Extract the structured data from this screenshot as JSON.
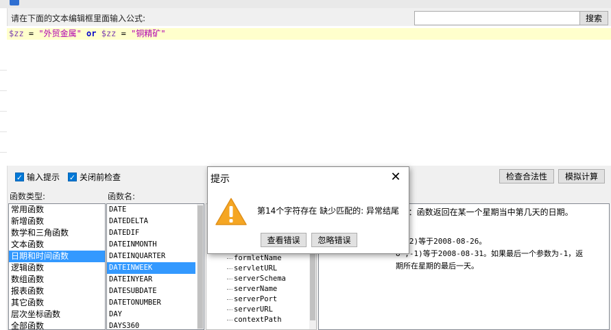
{
  "prompt_label": "请在下面的文本编辑框里面输入公式:",
  "search": {
    "value": "",
    "button_label": "搜索"
  },
  "editor": {
    "tokens": [
      "$zz",
      " = ",
      "\"外贸金属\"",
      " or ",
      "$zz",
      " = ",
      "\"铜精矿\""
    ]
  },
  "options": {
    "input_hint_label": "输入提示",
    "input_hint_checked": true,
    "check_on_close_label": "关闭前检查",
    "check_on_close_checked": true,
    "check_validity_label": "检查合法性",
    "simulate_label": "模拟计算"
  },
  "function_types": {
    "label": "函数类型:",
    "items": [
      "常用函数",
      "新增函数",
      "数学和三角函数",
      "文本函数",
      "日期和时间函数",
      "逻辑函数",
      "数组函数",
      "报表函数",
      "其它函数",
      "层次坐标函数",
      "全部函数"
    ],
    "selected_index": 4
  },
  "function_names": {
    "label": "函数名:",
    "items": [
      "DATE",
      "DATEDELTA",
      "DATEDIF",
      "DATEINMONTH",
      "DATEINQUARTER",
      "DATEINWEEK",
      "DATEINYEAR",
      "DATESUBDATE",
      "DATETONUMBER",
      "DAY",
      "DAYS360"
    ],
    "selected_index": 5
  },
  "params": {
    "items": [
      "formletName",
      "servletURL",
      "serverSchema",
      "serverName",
      "serverPort",
      "serverURL",
      "contextPath"
    ]
  },
  "description": {
    "lines": [
      ")：函数返回在某一个星期当中第几天的日期。",
      "",
      "8\",2)等于2008-08-26。",
      "8\",-1)等于2008-08-31。如果最后一个参数为-1，返",
      "期所在星期的最后一天。"
    ]
  },
  "dialog": {
    "title": "提示",
    "message": "第14个字符存在 缺少匹配的:  异常结尾",
    "view_error_label": "查看错误",
    "ignore_error_label": "忽略错误",
    "icon": "warning-icon",
    "close_icon": "close-icon"
  },
  "colors": {
    "selection": "#3399ff",
    "editor_highlight": "#ffffcc",
    "warning": "#f5a623",
    "checkbox": "#0078d7"
  }
}
